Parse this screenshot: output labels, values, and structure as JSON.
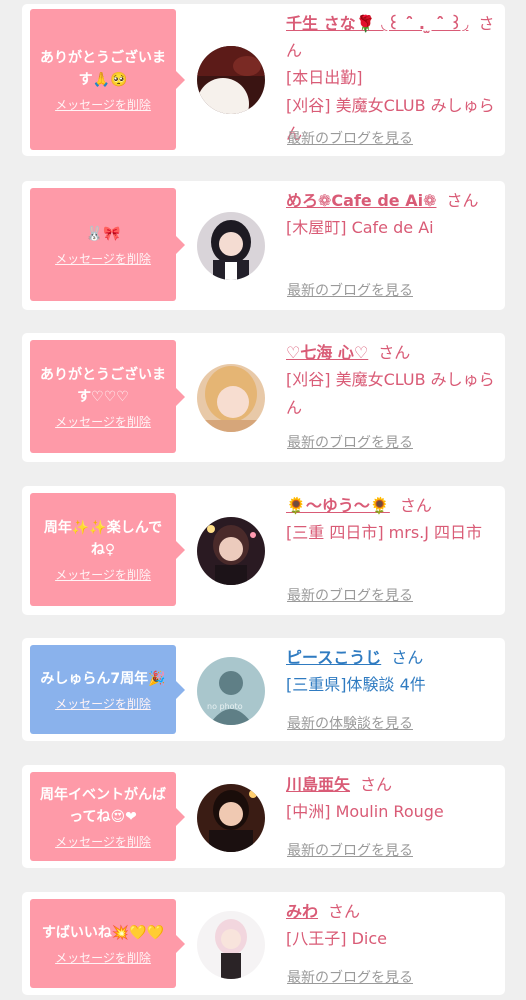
{
  "delete_label": "メッセージを削除",
  "colors": {
    "pink": "#fe9aa8",
    "blue": "#8ab2ec",
    "name_pink": "#d95b76",
    "name_blue": "#2f7bc1"
  },
  "items": [
    {
      "message": "ありがとうございます🙏🥺",
      "name": "千生 さな🌹 ◟꒰ ˆ̑ . ̫ ˆ̑ ꒱◞",
      "san": "さん",
      "details": [
        "[本日出勤]",
        "[刈谷] 美魔女CLUB みしゅらん"
      ],
      "latest": "最新のブログを見る",
      "avatar_icon": "photo-avatar"
    },
    {
      "message": "🐰🎀",
      "name": "めろ❁Cafe de Ai❁",
      "san": "さん",
      "details": [
        "[木屋町] Cafe de Ai"
      ],
      "latest": "最新のブログを見る",
      "avatar_icon": "photo-avatar"
    },
    {
      "message": "ありがとうございます♡♡♡",
      "name": "♡七海 心♡",
      "san": "さん",
      "details": [
        "[刈谷] 美魔女CLUB みしゅらん"
      ],
      "latest": "最新のブログを見る",
      "avatar_icon": "photo-avatar"
    },
    {
      "message": "周年✨✨楽しんでね♀",
      "name": "🌻〜ゆう〜🌻",
      "san": "さん",
      "details": [
        "[三重 四日市] mrs.J 四日市"
      ],
      "latest": "最新のブログを見る",
      "avatar_icon": "photo-avatar"
    },
    {
      "message": "みしゅらん7周年🎉",
      "name": "ピースこうじ",
      "san": "さん",
      "details": [
        "[三重県]体験談 4件"
      ],
      "latest": "最新の体験談を見る",
      "avatar_icon": "no-photo-avatar",
      "avatar_text": "no photo"
    },
    {
      "message": "周年イベントがんばってね😍❤",
      "name": "川島亜矢",
      "san": "さん",
      "details": [
        "[中洲] Moulin Rouge"
      ],
      "latest": "最新のブログを見る",
      "avatar_icon": "photo-avatar"
    },
    {
      "message": "すばいいね💥💛💛",
      "name": "みわ",
      "san": "さん",
      "details": [
        "[八王子] Dice"
      ],
      "latest": "最新のブログを見る",
      "avatar_icon": "photo-avatar"
    }
  ]
}
